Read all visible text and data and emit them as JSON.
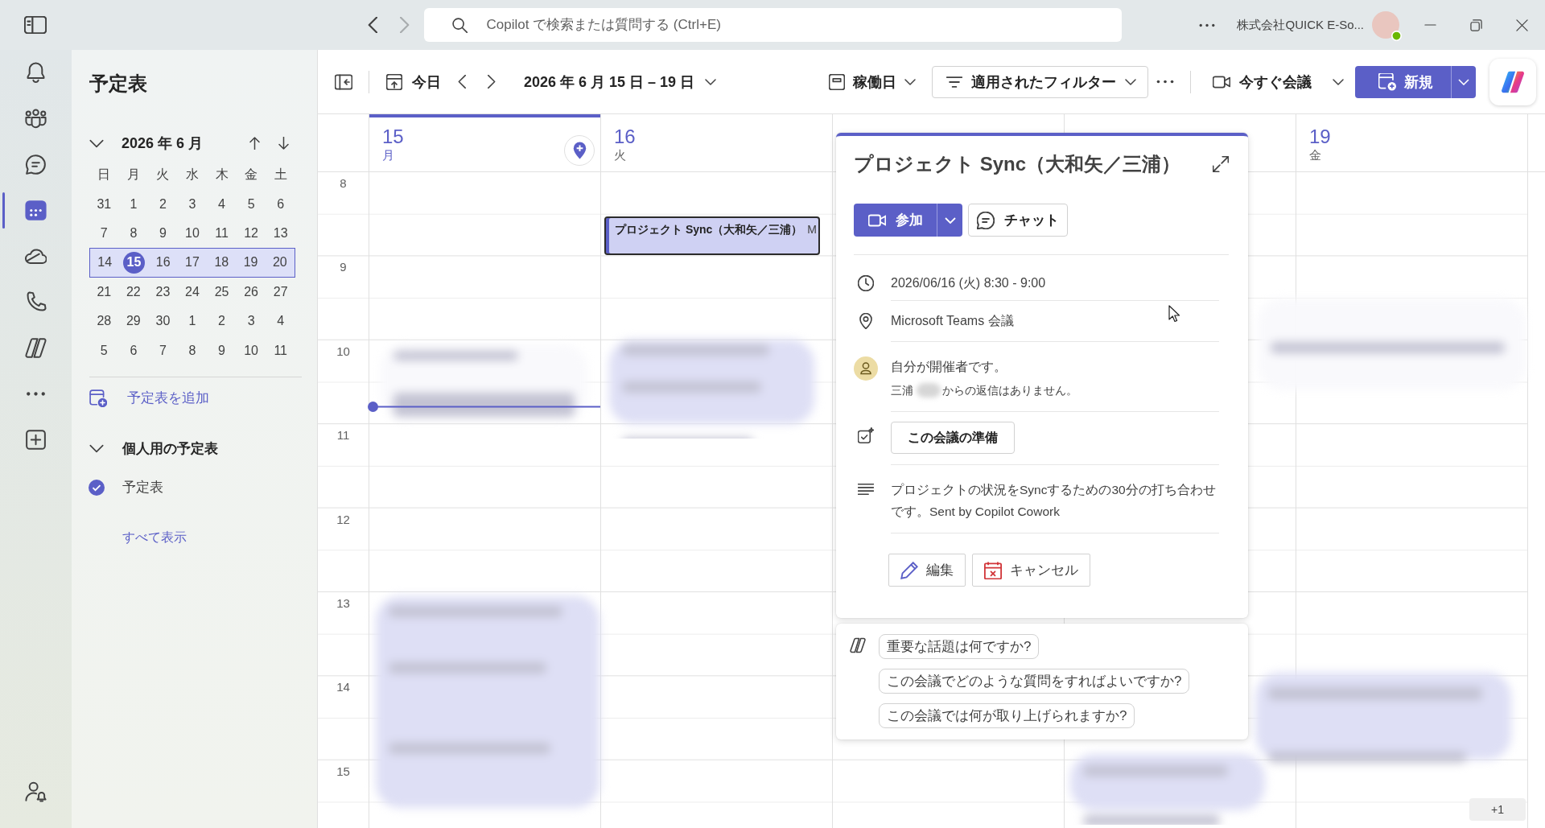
{
  "title_bar": {
    "search": {
      "placeholder": "Copilot で検索または質問する (Ctrl+E)"
    },
    "account": "株式会社QUICK E-So..."
  },
  "app_rail": {
    "items": [
      {
        "kind": "bell",
        "selected": false
      },
      {
        "kind": "people",
        "selected": false
      },
      {
        "kind": "chat",
        "selected": false
      },
      {
        "kind": "calendar",
        "selected": true
      },
      {
        "kind": "cloud",
        "selected": false
      },
      {
        "kind": "phone",
        "selected": false
      },
      {
        "kind": "copilot",
        "selected": false
      },
      {
        "kind": "more",
        "selected": false
      },
      {
        "kind": "add",
        "selected": false
      }
    ],
    "bottom": [
      {
        "kind": "person-bell",
        "selected": false
      }
    ]
  },
  "sidebar": {
    "title": "予定表",
    "month": {
      "label": "2026 年 6 月",
      "expanded": true
    },
    "weekdays": [
      "日",
      "月",
      "火",
      "水",
      "木",
      "金",
      "土"
    ],
    "weeks": [
      {
        "selected": false,
        "days": [
          {
            "label": "31",
            "today": false
          },
          {
            "label": "1",
            "today": false
          },
          {
            "label": "2",
            "today": false
          },
          {
            "label": "3",
            "today": false
          },
          {
            "label": "4",
            "today": false
          },
          {
            "label": "5",
            "today": false
          },
          {
            "label": "6",
            "today": false
          }
        ]
      },
      {
        "selected": false,
        "days": [
          {
            "label": "7",
            "today": false
          },
          {
            "label": "8",
            "today": false
          },
          {
            "label": "9",
            "today": false
          },
          {
            "label": "10",
            "today": false
          },
          {
            "label": "11",
            "today": false
          },
          {
            "label": "12",
            "today": false
          },
          {
            "label": "13",
            "today": false
          }
        ]
      },
      {
        "selected": true,
        "days": [
          {
            "label": "14",
            "today": false
          },
          {
            "label": "15",
            "today": true
          },
          {
            "label": "16",
            "today": false
          },
          {
            "label": "17",
            "today": false
          },
          {
            "label": "18",
            "today": false
          },
          {
            "label": "19",
            "today": false
          },
          {
            "label": "20",
            "today": false
          }
        ]
      },
      {
        "selected": false,
        "days": [
          {
            "label": "21",
            "today": false
          },
          {
            "label": "22",
            "today": false
          },
          {
            "label": "23",
            "today": false
          },
          {
            "label": "24",
            "today": false
          },
          {
            "label": "25",
            "today": false
          },
          {
            "label": "26",
            "today": false
          },
          {
            "label": "27",
            "today": false
          }
        ]
      },
      {
        "selected": false,
        "days": [
          {
            "label": "28",
            "today": false
          },
          {
            "label": "29",
            "today": false
          },
          {
            "label": "30",
            "today": false
          },
          {
            "label": "1",
            "today": false
          },
          {
            "label": "2",
            "today": false
          },
          {
            "label": "3",
            "today": false
          },
          {
            "label": "4",
            "today": false
          }
        ]
      },
      {
        "selected": false,
        "days": [
          {
            "label": "5",
            "today": false
          },
          {
            "label": "6",
            "today": false
          },
          {
            "label": "7",
            "today": false
          },
          {
            "label": "8",
            "today": false
          },
          {
            "label": "9",
            "today": false
          },
          {
            "label": "10",
            "today": false
          },
          {
            "label": "11",
            "today": false
          }
        ]
      }
    ],
    "add_calendar": "予定表を追加",
    "personal": {
      "label": "個人用の予定表",
      "expanded": true,
      "calendars": [
        {
          "label": "予定表",
          "checked": true
        }
      ]
    },
    "show_all": "すべて表示"
  },
  "toolbar": {
    "today": "今日",
    "range": "2026 年 6 月 15 日 – 19 日",
    "view": "稼働日",
    "filter": "適用されたフィルター",
    "meet_now": "今すぐ会議",
    "new": "新規"
  },
  "calendar": {
    "days": [
      {
        "date": "15",
        "weekday": "月",
        "today": true
      },
      {
        "date": "16",
        "weekday": "火",
        "today": false,
        "events": [
          {
            "title": "プロジェクト Sync（大和矢／三浦）",
            "location": "M",
            "selected": true
          }
        ]
      },
      {
        "today": false
      },
      {
        "today": false
      },
      {
        "date": "19",
        "weekday": "金",
        "today": false
      }
    ],
    "hours": [
      "8",
      "9",
      "10",
      "11",
      "12",
      "13",
      "14",
      "15"
    ],
    "more_badge": "+1"
  },
  "event_card": {
    "title": "プロジェクト Sync（大和矢／三浦）",
    "join": "参加",
    "chat": "チャット",
    "time": "2026/06/16 (火) 8:30 - 9:00",
    "location": "Microsoft Teams 会議",
    "organizer": "自分が開催者です。",
    "reply": {
      "name": "三浦",
      "text": "からの返信はありません。"
    },
    "prepare": "この会議の準備",
    "description": "プロジェクトの状況をSyncするための30分の打ち合わせです。Sent by Copilot Cowork",
    "edit": "編集",
    "cancel": "キャンセル"
  },
  "copilot_prompts": [
    "重要な話題は何ですか?",
    "この会議でどのような質問をすればよいですか?",
    "この会議では何が取り上げられますか?"
  ]
}
